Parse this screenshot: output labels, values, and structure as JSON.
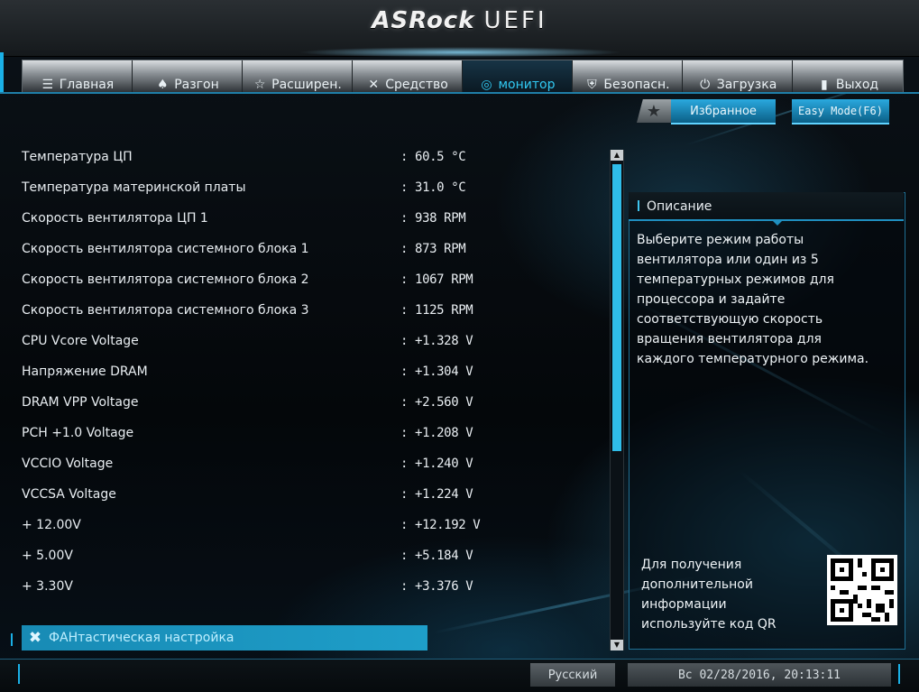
{
  "header": {
    "brand": "ASRock",
    "product": "UEFI"
  },
  "tabs": [
    {
      "label": "Главная",
      "icon": "list-icon",
      "glyph": "☰"
    },
    {
      "label": "Разгон",
      "icon": "rocket-icon",
      "glyph": "♠"
    },
    {
      "label": "Расширен.",
      "icon": "star-icon",
      "glyph": "☆"
    },
    {
      "label": "Средство",
      "icon": "tools-icon",
      "glyph": "✕"
    },
    {
      "label": "монитор",
      "icon": "monitor-icon",
      "glyph": "◎"
    },
    {
      "label": "Безопасн.",
      "icon": "shield-icon",
      "glyph": "⛨"
    },
    {
      "label": "Загрузка",
      "icon": "power-icon",
      "glyph": "⏻"
    },
    {
      "label": "Выход",
      "icon": "exit-icon",
      "glyph": "▮"
    }
  ],
  "active_tab": "монитор",
  "toolbar": {
    "favorites_label": "Избранное",
    "easy_mode_label": "Easy Mode(F6)"
  },
  "readings": [
    {
      "label": "Температура ЦП",
      "value": ": 60.5 °C"
    },
    {
      "label": "Температура материнской платы",
      "value": ": 31.0 °C"
    },
    {
      "label": "Скорость вентилятора ЦП 1",
      "value": ": 938 RPM"
    },
    {
      "label": "Скорость вентилятора системного блока 1",
      "value": ": 873 RPM"
    },
    {
      "label": "Скорость вентилятора системного блока 2",
      "value": ": 1067 RPM"
    },
    {
      "label": "Скорость вентилятора системного блока 3",
      "value": ": 1125 RPM"
    },
    {
      "label": "CPU Vcore Voltage",
      "value": ": +1.328 V"
    },
    {
      "label": "Напряжение DRAM",
      "value": ": +1.304 V"
    },
    {
      "label": "DRAM VPP Voltage",
      "value": ": +2.560 V"
    },
    {
      "label": "PCH +1.0 Voltage",
      "value": ": +1.208 V"
    },
    {
      "label": "VCCIO Voltage",
      "value": ": +1.240 V"
    },
    {
      "label": "VCCSA Voltage",
      "value": ": +1.224 V"
    },
    {
      "label": "+ 12.00V",
      "value": ": +12.192 V"
    },
    {
      "label": "+ 5.00V",
      "value": ": +5.184 V"
    },
    {
      "label": "+ 3.30V",
      "value": ": +3.376 V"
    }
  ],
  "fan_tuning": {
    "label": "ФАНтастическая настройка"
  },
  "description": {
    "title": "Описание",
    "text": "Выберите режим работы\nвентилятора или один из 5\nтемпературных режимов для\nпроцессора и задайте\nсоответствующую скорость\nвращения вентилятора для\nкаждого температурного режима."
  },
  "qr_info": {
    "text": "Для получения\nдополнительной\nинформации\nиспользуйте код QR"
  },
  "footer": {
    "language": "Русский",
    "datetime": "Вс 02/28/2016, 20:13:11"
  },
  "colors": {
    "accent": "#1ab0e6",
    "active_tab_text": "#31c9f2",
    "fan_row": "#1e9ec9"
  }
}
